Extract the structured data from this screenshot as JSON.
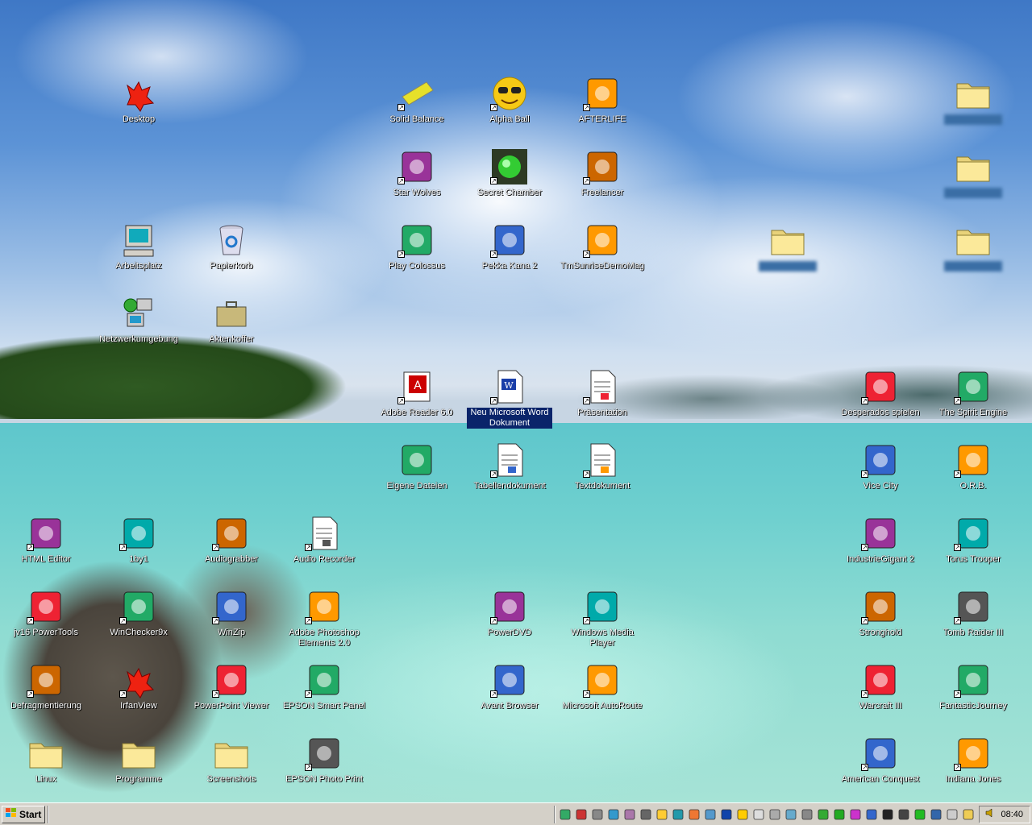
{
  "desktop": {
    "icons": [
      {
        "label": "Desktop",
        "icon": "irfanview-fox-icon"
      },
      {
        "label": "Solid Balance",
        "icon": "yellow-bar-icon"
      },
      {
        "label": "Alpha Ball",
        "icon": "smiley-sunglasses-icon"
      },
      {
        "label": "AFTERLIFE",
        "icon": "afterlife-icon"
      },
      {
        "label": "Star Wolves",
        "icon": "star-wolves-icon"
      },
      {
        "label": "Secret Chamber",
        "icon": "green-orb-icon"
      },
      {
        "label": "Freelancer",
        "icon": "freelancer-helmet-icon"
      },
      {
        "label": "Arbeitsplatz",
        "icon": "my-computer-icon"
      },
      {
        "label": "Papierkorb",
        "icon": "recycle-bin-icon"
      },
      {
        "label": "Play Colossus",
        "icon": "colossus-icon"
      },
      {
        "label": "Pekka Kana 2",
        "icon": "pekka-kana-icon"
      },
      {
        "label": "TmSunriseDemoMag",
        "icon": "trackmania-icon"
      },
      {
        "label": "Netzwerkumgebung",
        "icon": "network-icon"
      },
      {
        "label": "Aktenkoffer",
        "icon": "briefcase-icon"
      },
      {
        "label": "Adobe Reader 6.0",
        "icon": "adobe-reader-icon"
      },
      {
        "label": "Neu Microsoft Word Dokument",
        "icon": "word-document-icon"
      },
      {
        "label": "Präsentation",
        "icon": "presentation-icon"
      },
      {
        "label": "Eigene Dateien",
        "icon": "my-documents-icon"
      },
      {
        "label": "Tabellendokument",
        "icon": "spreadsheet-icon"
      },
      {
        "label": "Textdokument",
        "icon": "text-document-icon"
      },
      {
        "label": "HTML Editor",
        "icon": "html-editor-icon"
      },
      {
        "label": "1by1",
        "icon": "1by1-icon"
      },
      {
        "label": "Audiograbber",
        "icon": "audiograbber-hand-icon"
      },
      {
        "label": "Audio Recorder",
        "icon": "notepad-icon"
      },
      {
        "label": "jv16 PowerTools",
        "icon": "lightbulb-icon"
      },
      {
        "label": "WinChecker9x",
        "icon": "winchecker-icon"
      },
      {
        "label": "WinZip",
        "icon": "winzip-icon"
      },
      {
        "label": "Adobe Photoshop Elements 2.0",
        "icon": "sunflower-icon"
      },
      {
        "label": "PowerDVD",
        "icon": "powerdvd-icon"
      },
      {
        "label": "Windows Media Player",
        "icon": "media-player-icon"
      },
      {
        "label": "Defragmentierung",
        "icon": "defrag-icon"
      },
      {
        "label": "IrfanView",
        "icon": "irfanview-fox-icon"
      },
      {
        "label": "PowerPoint Viewer",
        "icon": "powerpoint-icon"
      },
      {
        "label": "EPSON Smart Panel",
        "icon": "smart-bulb-icon"
      },
      {
        "label": "Avant Browser",
        "icon": "avant-browser-icon"
      },
      {
        "label": "Microsoft AutoRoute",
        "icon": "autoroute-icon"
      },
      {
        "label": "Linux",
        "icon": "folder-icon"
      },
      {
        "label": "Programme",
        "icon": "folder-icon"
      },
      {
        "label": "Screenshots",
        "icon": "folder-icon"
      },
      {
        "label": "EPSON Photo Print",
        "icon": "photo-print-icon"
      },
      {
        "label": "Desperados spielen",
        "icon": "desperados-icon"
      },
      {
        "label": "The Spirit Engine",
        "icon": "spirit-engine-icon"
      },
      {
        "label": "Vice City",
        "icon": "vice-city-icon"
      },
      {
        "label": "O.R.B.",
        "icon": "orb-icon"
      },
      {
        "label": "IndustrieGigant 2",
        "icon": "gear-icon"
      },
      {
        "label": "Torus Trooper",
        "icon": "torus-trooper-icon"
      },
      {
        "label": "Stronghold",
        "icon": "castle-shield-icon"
      },
      {
        "label": "Tomb Raider III",
        "icon": "tomb-raider-icon"
      },
      {
        "label": "Warcraft III",
        "icon": "orc-face-icon"
      },
      {
        "label": "FantasticJourney",
        "icon": "sphere-icon"
      },
      {
        "label": "American Conquest",
        "icon": "american-conquest-icon"
      },
      {
        "label": "Indiana Jones",
        "icon": "indiana-jones-icon"
      },
      {
        "label": "",
        "icon": "folder-icon"
      },
      {
        "label": "",
        "icon": "folder-icon"
      },
      {
        "label": "",
        "icon": "folder-icon"
      },
      {
        "label": "",
        "icon": "folder-icon"
      }
    ]
  },
  "taskbar": {
    "start_label": "Start",
    "clock": "08:40",
    "quicklaunch": [
      "show-desktop-icon",
      "ie-icon",
      "drive-icon",
      "disk-icon",
      "cube-icon",
      "printer-icon",
      "notepad-icon",
      "monitor-icon",
      "palette-icon",
      "help-icon",
      "word-icon",
      "sunflower-icon",
      "document-icon",
      "calculator-icon",
      "network-icon",
      "recycle-icon",
      "shield-icon",
      "green-icon",
      "lamp-icon",
      "flag-icon",
      "terminal-icon",
      "headset-icon",
      "leaf-icon",
      "window-icon",
      "window2-icon",
      "folder-icon"
    ],
    "tray": [
      "speaker-icon"
    ]
  },
  "colors": {
    "selection": "#0a246a",
    "taskbar": "#d4d0c8"
  }
}
